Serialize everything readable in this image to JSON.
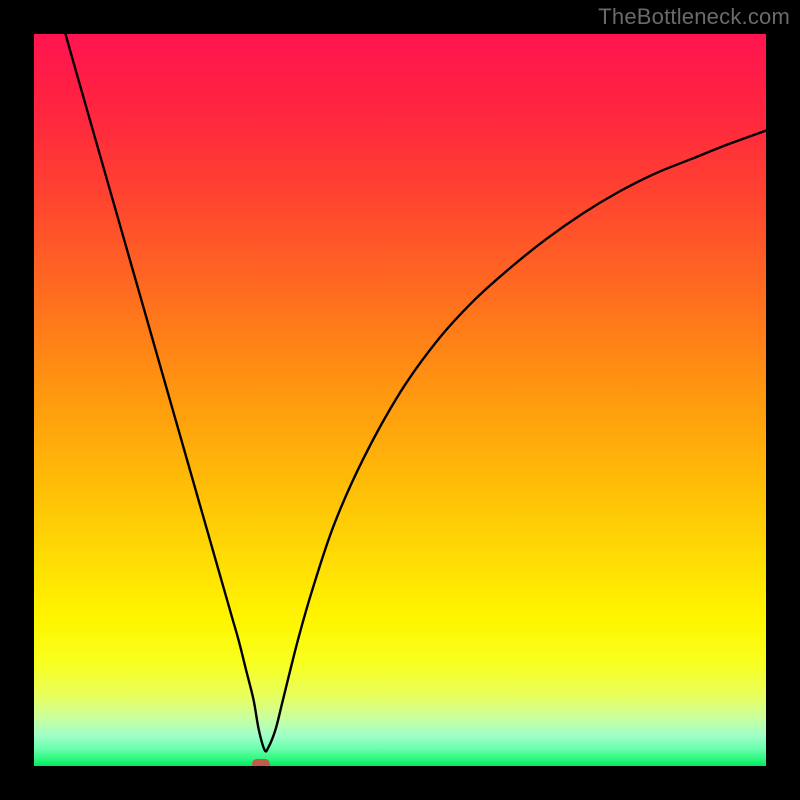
{
  "watermark": "TheBottleneck.com",
  "chart_data": {
    "type": "line",
    "title": "",
    "xlabel": "",
    "ylabel": "",
    "xlim": [
      0,
      100
    ],
    "ylim": [
      0,
      100
    ],
    "grid": false,
    "legend": false,
    "annotations": [],
    "series": [
      {
        "name": "curve",
        "color": "#000000",
        "x": [
          4.3,
          6,
          8,
          10,
          12,
          14,
          16,
          18,
          20,
          22,
          24,
          26,
          27,
          28,
          29,
          30,
          30.7,
          31.5,
          32,
          33,
          34,
          36,
          38,
          41,
          45,
          50,
          55,
          60,
          65,
          70,
          75,
          80,
          85,
          90,
          95,
          100
        ],
        "y": [
          100,
          94,
          87,
          80,
          73,
          66,
          59,
          52,
          45,
          38,
          31,
          24,
          20.5,
          17,
          13,
          9,
          5,
          2.2,
          2.5,
          5,
          9,
          17,
          24,
          33,
          42,
          51,
          58,
          63.5,
          68,
          72,
          75.5,
          78.5,
          81,
          83,
          85,
          86.8
        ]
      }
    ],
    "marker": {
      "x": 31,
      "y": 0,
      "color": "#c05a4b"
    },
    "background_gradient": {
      "stops": [
        {
          "offset": 0.0,
          "color": "#ff1450"
        },
        {
          "offset": 0.1,
          "color": "#ff2440"
        },
        {
          "offset": 0.22,
          "color": "#ff4330"
        },
        {
          "offset": 0.35,
          "color": "#ff6b20"
        },
        {
          "offset": 0.48,
          "color": "#ff9410"
        },
        {
          "offset": 0.6,
          "color": "#ffb808"
        },
        {
          "offset": 0.72,
          "color": "#ffdd04"
        },
        {
          "offset": 0.8,
          "color": "#fff600"
        },
        {
          "offset": 0.86,
          "color": "#f8ff20"
        },
        {
          "offset": 0.905,
          "color": "#e8ff60"
        },
        {
          "offset": 0.935,
          "color": "#c8ffa0"
        },
        {
          "offset": 0.958,
          "color": "#a0ffc8"
        },
        {
          "offset": 0.975,
          "color": "#70ffb0"
        },
        {
          "offset": 0.99,
          "color": "#30f880"
        },
        {
          "offset": 1.0,
          "color": "#00e860"
        }
      ]
    }
  }
}
